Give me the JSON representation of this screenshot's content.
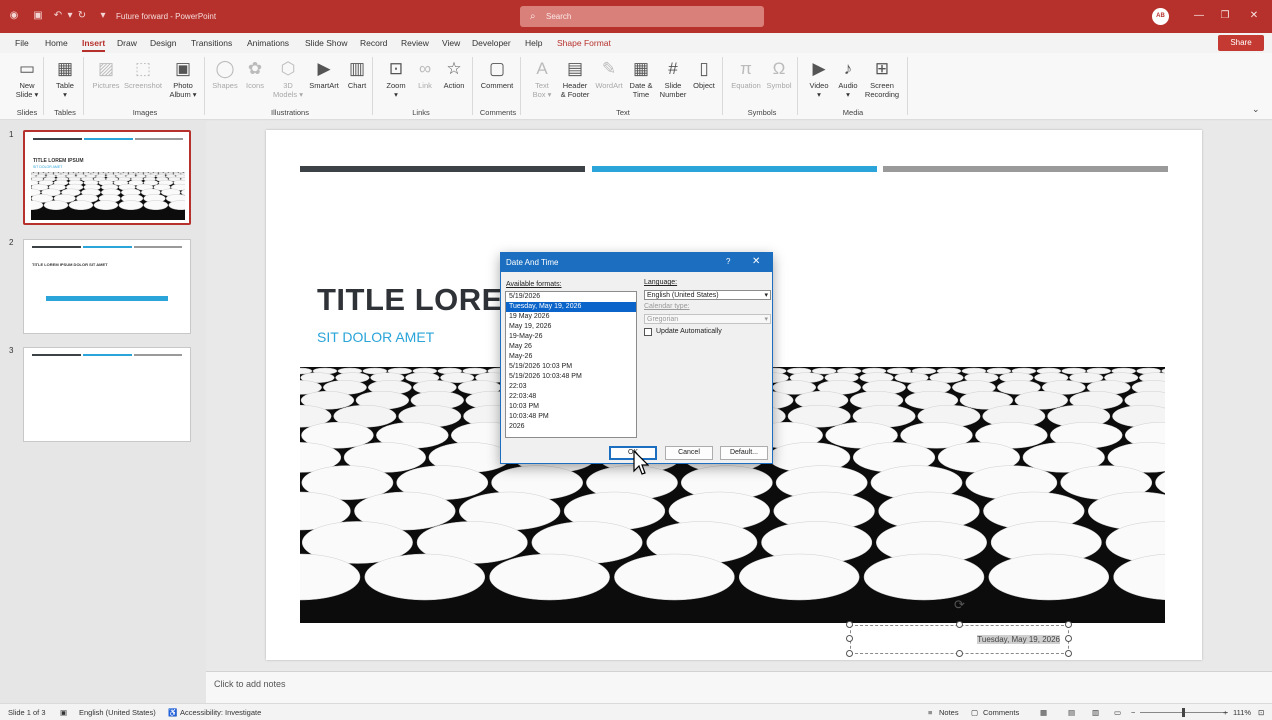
{
  "app": {
    "document_title": "Future forward",
    "app_name": "PowerPoint",
    "search_placeholder": "Search",
    "avatar_initials": "AB"
  },
  "ribbon_tabs": [
    "File",
    "Home",
    "Insert",
    "Draw",
    "Design",
    "Transitions",
    "Animations",
    "Slide Show",
    "Record",
    "Review",
    "View",
    "Developer",
    "Help",
    "Shape Format"
  ],
  "active_tab": "Insert",
  "share_label": "Share",
  "ribbon": {
    "buttons": [
      {
        "l1": "New",
        "l2": "Slide ▾",
        "icon": "new-slide-icon",
        "glyph": "▭"
      },
      {
        "l1": "Table",
        "l2": "▾",
        "icon": "table-icon",
        "glyph": "▦"
      },
      {
        "l1": "Pictures",
        "l2": "",
        "icon": "pictures-icon",
        "glyph": "▨"
      },
      {
        "l1": "Screenshot",
        "l2": "",
        "icon": "screenshot-icon",
        "glyph": "⬚"
      },
      {
        "l1": "Photo",
        "l2": "Album ▾",
        "icon": "photo-album-icon",
        "glyph": "▣"
      },
      {
        "l1": "Shapes",
        "l2": "",
        "icon": "shapes-icon",
        "glyph": "◯"
      },
      {
        "l1": "Icons",
        "l2": "",
        "icon": "icons-icon",
        "glyph": "✿"
      },
      {
        "l1": "3D",
        "l2": "Models ▾",
        "icon": "3d-models-icon",
        "glyph": "⬡"
      },
      {
        "l1": "SmartArt",
        "l2": "",
        "icon": "smartart-icon",
        "glyph": "▶"
      },
      {
        "l1": "Chart",
        "l2": "",
        "icon": "chart-icon",
        "glyph": "▥"
      },
      {
        "l1": "Zoom",
        "l2": "▾",
        "icon": "zoom-icon",
        "glyph": "⊡"
      },
      {
        "l1": "Link",
        "l2": "",
        "icon": "link-icon",
        "glyph": "∞"
      },
      {
        "l1": "Action",
        "l2": "",
        "icon": "action-icon",
        "glyph": "☆"
      },
      {
        "l1": "Comment",
        "l2": "",
        "icon": "comment-icon",
        "glyph": "▢"
      },
      {
        "l1": "Text",
        "l2": "Box ▾",
        "icon": "text-box-icon",
        "glyph": "A"
      },
      {
        "l1": "Header",
        "l2": "& Footer",
        "icon": "header-footer-icon",
        "glyph": "▤"
      },
      {
        "l1": "WordArt",
        "l2": "",
        "icon": "wordart-icon",
        "glyph": "✎"
      },
      {
        "l1": "Date &",
        "l2": "Time",
        "icon": "date-time-icon",
        "glyph": "▦"
      },
      {
        "l1": "Slide",
        "l2": "Number",
        "icon": "slide-number-icon",
        "glyph": "#"
      },
      {
        "l1": "Object",
        "l2": "",
        "icon": "object-icon",
        "glyph": "▯"
      },
      {
        "l1": "Equation",
        "l2": "",
        "icon": "equation-icon",
        "glyph": "π"
      },
      {
        "l1": "Symbol",
        "l2": "",
        "icon": "symbol-icon",
        "glyph": "Ω"
      },
      {
        "l1": "Video",
        "l2": "▾",
        "icon": "video-icon",
        "glyph": "▶"
      },
      {
        "l1": "Audio",
        "l2": "▾",
        "icon": "audio-icon",
        "glyph": "♪"
      },
      {
        "l1": "Screen",
        "l2": "Recording",
        "icon": "screen-recording-icon",
        "glyph": "⊞"
      }
    ],
    "groups": [
      "Slides",
      "Tables",
      "Images",
      "Illustrations",
      "Links",
      "Comments",
      "Text",
      "Symbols",
      "Media"
    ]
  },
  "slides": {
    "numbers": [
      "1",
      "2",
      "3"
    ],
    "thumb1_title": "TITLE LOREM IPSUM",
    "thumb1_sub": "SIT DOLOR AMET",
    "thumb2_title": "TITLE LOREM IPSUM DOLOR SIT AMET"
  },
  "slide": {
    "title": "TITLE LOREM IPSUM",
    "subtitle": "SIT DOLOR AMET",
    "date_text": "Tuesday, May 19, 2026",
    "bar_colors": [
      "#3d4246",
      "#2aa4d9",
      "#9a9a9a"
    ]
  },
  "notes_placeholder": "Click to add notes",
  "dialog": {
    "title": "Date And Time",
    "help": "?",
    "available_formats_label": "Available formats:",
    "formats": [
      "5/19/2026",
      "Tuesday, May 19, 2026",
      "19 May 2026",
      "May 19, 2026",
      "19-May-26",
      "May 26",
      "May-26",
      "5/19/2026 10:03 PM",
      "5/19/2026 10:03:48 PM",
      "22:03",
      "22:03:48",
      "10:03 PM",
      "10:03:48 PM",
      "2026"
    ],
    "selected_index": 1,
    "language_label": "Language:",
    "language_value": "English (United States)",
    "calendar_label": "Calendar type:",
    "calendar_value": "Gregorian",
    "update_label": "Update Automatically",
    "ok": "OK",
    "cancel": "Cancel",
    "default": "Default..."
  },
  "status": {
    "slide_count": "Slide 1 of 3",
    "language": "English (United States)",
    "accessibility": "Accessibility: Investigate",
    "notes": "Notes",
    "comments": "Comments",
    "zoom": "111%"
  }
}
